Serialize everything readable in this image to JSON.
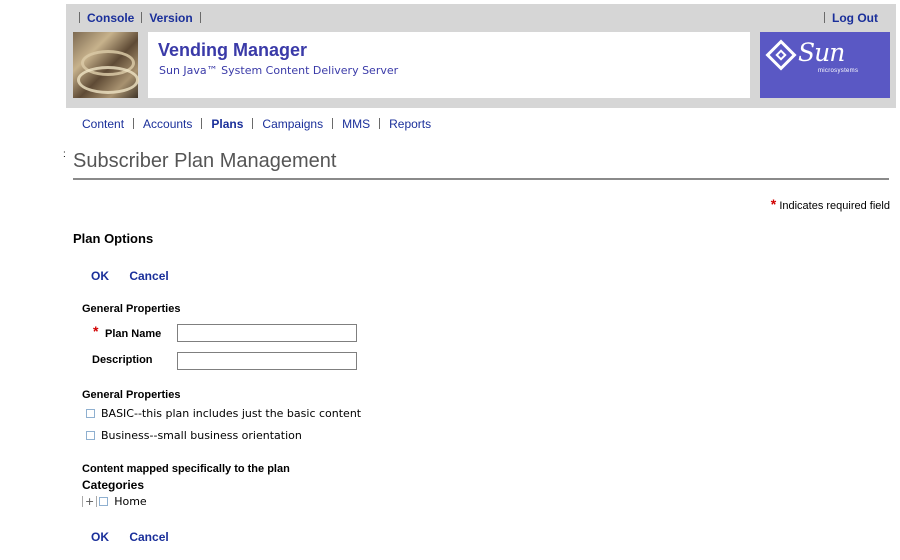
{
  "masthead": {
    "util_left": [
      "Console",
      "Version"
    ],
    "util_right": "Log Out",
    "app_title": "Vending Manager",
    "app_subtitle": "Sun Java™ System Content Delivery Server",
    "brand_logo_text": "Sun",
    "brand_logo_sub": "microsystems"
  },
  "tabs": [
    {
      "label": "Content",
      "active": false
    },
    {
      "label": "Accounts",
      "active": false
    },
    {
      "label": "Plans",
      "active": true
    },
    {
      "label": "Campaigns",
      "active": false
    },
    {
      "label": "MMS",
      "active": false
    },
    {
      "label": "Reports",
      "active": false
    }
  ],
  "stray_mark": ":",
  "page": {
    "title": "Subscriber Plan Management",
    "required_marker": "*",
    "required_note": "Indicates required field",
    "section_title": "Plan Options"
  },
  "buttons": {
    "ok": "OK",
    "cancel": "Cancel"
  },
  "general1": {
    "heading": "General Properties",
    "plan_name_label": "Plan Name",
    "plan_name_value": "",
    "description_label": "Description",
    "description_value": ""
  },
  "general2": {
    "heading": "General Properties",
    "options": [
      {
        "label": "BASIC--this plan includes just the basic content",
        "checked": false
      },
      {
        "label": "Business--small business orientation",
        "checked": false
      }
    ]
  },
  "content_map": {
    "heading": "Content mapped specifically to the plan",
    "categories_label": "Categories",
    "tree_expander": "+",
    "tree_items": [
      {
        "label": "Home",
        "checked": false
      }
    ]
  },
  "colors": {
    "link": "#1a2f9a",
    "title_text": "#3a3aa8",
    "sun_logo_bg": "#5a58c4",
    "masthead_bg": "#d6d6d6",
    "required_star": "#d10000"
  }
}
